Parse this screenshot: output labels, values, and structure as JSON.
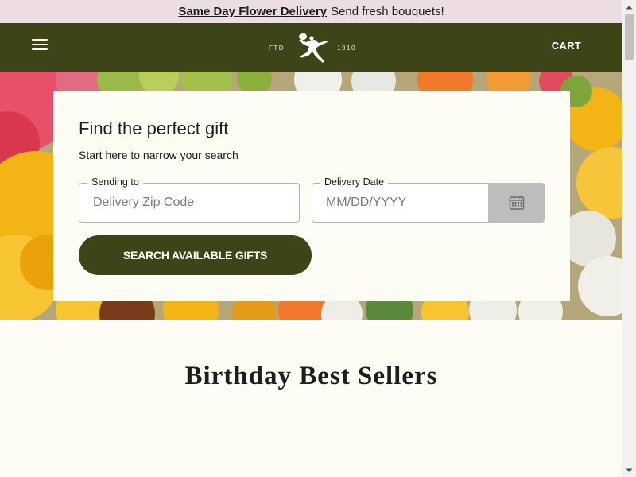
{
  "promo": {
    "link_text": "Same Day Flower Delivery",
    "text": "Send fresh bouquets!"
  },
  "header": {
    "logo_left": "FTD",
    "logo_right": "1910",
    "cart_label": "CART"
  },
  "search": {
    "title": "Find the perfect gift",
    "subtitle": "Start here to narrow your search",
    "zip_label": "Sending to",
    "zip_placeholder": "Delivery Zip Code",
    "date_label": "Delivery Date",
    "date_placeholder": "MM/DD/YYYY",
    "button_label": "Search available gifts"
  },
  "section": {
    "title": "Birthday Best Sellers"
  },
  "colors": {
    "brand_green": "#3d4518",
    "promo_pink": "#ecdde2",
    "page_bg": "#fdfcf5"
  }
}
